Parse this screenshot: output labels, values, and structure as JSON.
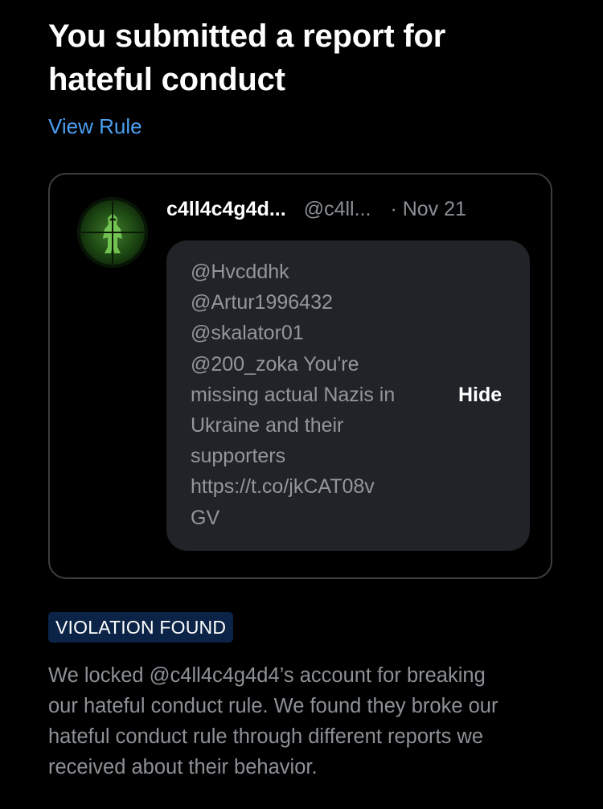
{
  "report": {
    "title_line1": "You submitted a report for",
    "title_line2": "hateful conduct",
    "view_rule_link": "View Rule"
  },
  "tweet": {
    "avatar_icon": "sniper-scope-avatar-icon",
    "display_name": "c4ll4c4g4d...",
    "handle": "@c4ll...",
    "date": "· Nov 21",
    "text_lines": [
      "@Hvcddhk",
      "@Artur1996432",
      "@skalator01",
      "@200_zoka You're",
      "missing actual Nazis in",
      "Ukraine and their",
      "supporters",
      "https://t.co/jkCAT08v",
      "GV"
    ],
    "hide_label": "Hide"
  },
  "result": {
    "badge": "VIOLATION FOUND",
    "description_lines": [
      "We locked @c4ll4c4g4d4’s account for breaking",
      "our hateful conduct rule. We found they broke our",
      "hateful conduct rule through different reports we",
      "received about their behavior."
    ]
  },
  "colors": {
    "background": "#000000",
    "link": "#4b9ff2",
    "badge_bg": "#0b2346",
    "tweet_box_bg": "#202327",
    "muted_text": "#8d9196"
  }
}
